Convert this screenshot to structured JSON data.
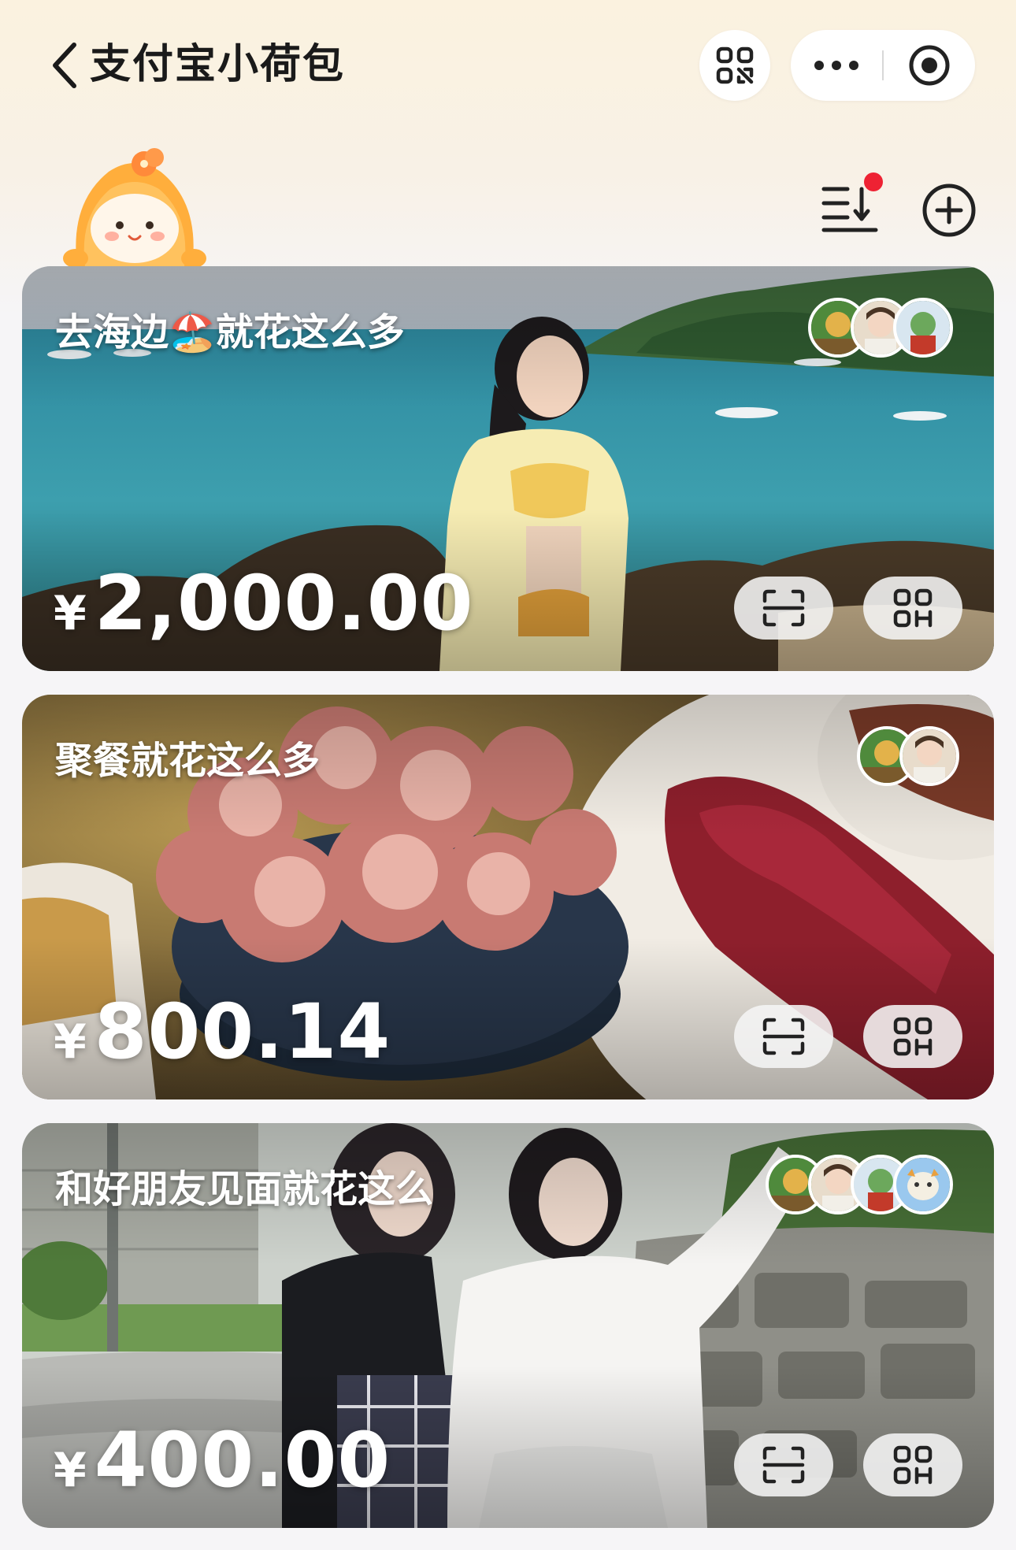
{
  "header": {
    "title": "支付宝小荷包",
    "back_icon": "chevron-left-icon",
    "scan_icon": "qr-scan-icon",
    "more_icon": "more-dots-icon",
    "close_icon": "target-close-icon"
  },
  "toolbar": {
    "sort_icon": "sort-list-icon",
    "add_icon": "add-circle-icon",
    "notification_dot": true
  },
  "cards": [
    {
      "title": "去海边🏖️就花这么多",
      "currency": "¥",
      "amount": "2,000.00",
      "members": 3,
      "scene": "beach"
    },
    {
      "title": "聚餐就花这么多",
      "currency": "¥",
      "amount": "800.14",
      "members": 2,
      "scene": "food"
    },
    {
      "title": "和好朋友见面就花这么",
      "currency": "¥",
      "amount": "400.00",
      "members": 4,
      "scene": "friends"
    }
  ],
  "colors": {
    "header_bg": "#fbf2df",
    "page_bg": "#f6f5f7",
    "title_text": "#1a1a1a",
    "badge_red": "#ee2233",
    "mascot_orange": "#ffae3c"
  }
}
